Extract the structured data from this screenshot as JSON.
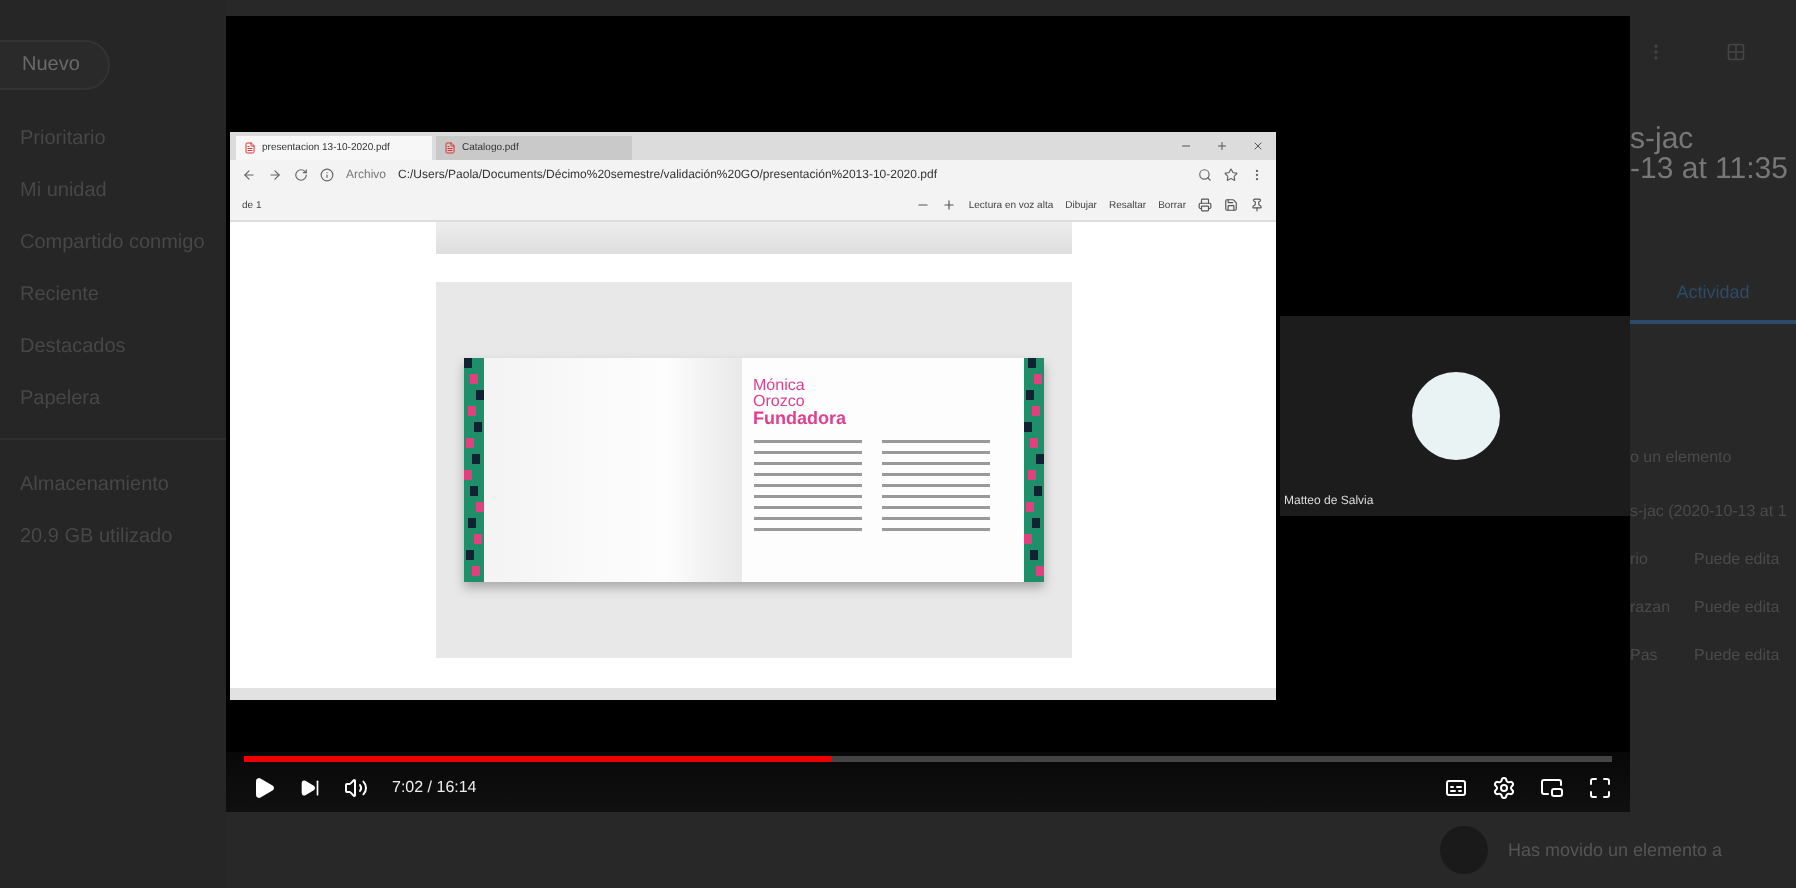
{
  "sidebar": {
    "new_button": "Nuevo",
    "items": [
      "Prioritario",
      "Mi unidad",
      "Compartido conmigo",
      "Reciente",
      "Destacados",
      "Papelera"
    ],
    "storage": {
      "label": "Almacenamiento",
      "usage": "20.9 GB utilizado"
    }
  },
  "video": {
    "browser": {
      "tabs": [
        {
          "label": "presentacion 13-10-2020.pdf",
          "selected": true
        },
        {
          "label": "Catalogo.pdf",
          "selected": false
        }
      ],
      "address_prefix": "Archivo",
      "address": "C:/Users/Paola/Documents/Décimo%20semestre/validación%20GO/presentación%2013-10-2020.pdf",
      "page_counter": "de 1",
      "tools": [
        "Lectura en voz alta",
        "Dibujar",
        "Resaltar",
        "Borrar"
      ],
      "document": {
        "title_lines": [
          "Mónica",
          "Orozco"
        ],
        "title_bold": "Fundadora"
      }
    },
    "participant": {
      "name": "Matteo de Salvia"
    },
    "player": {
      "level": 0.43,
      "time": "7:02 / 16:14"
    }
  },
  "details": {
    "title_lines": [
      "s-jac",
      "-13 at 11:35"
    ],
    "tab": {
      "label": "Actividad",
      "selected": true
    },
    "activity_heading": "o un elemento",
    "activity_subheading": "s-jac (2020-10-13 at 1",
    "access_rows": [
      {
        "name": "rio",
        "role": "Puede edita"
      },
      {
        "name": "razan",
        "role": "Puede edita"
      },
      {
        "name": "Pas",
        "role": "Puede edita"
      }
    ]
  },
  "activity_item": {
    "text": "Has movido un elemento a"
  }
}
